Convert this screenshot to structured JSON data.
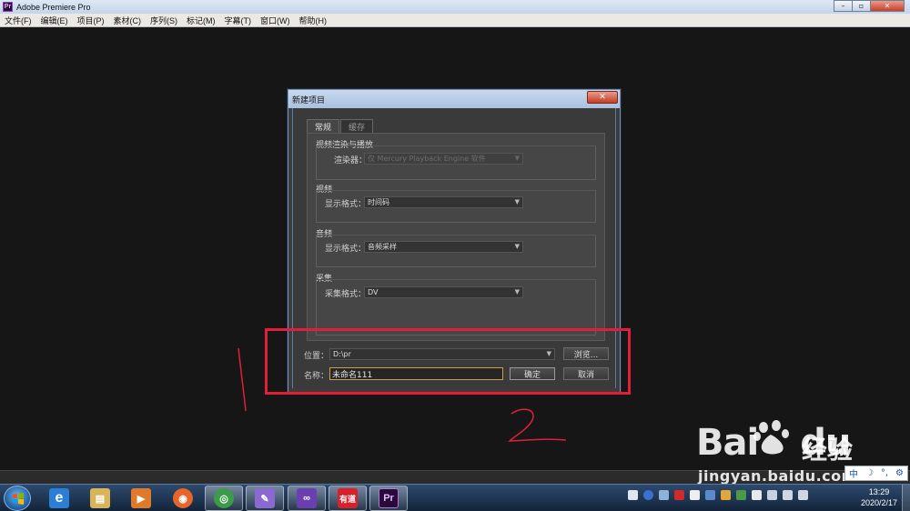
{
  "app": {
    "title": "Adobe Premiere Pro",
    "icon_label": "Pr",
    "controls": {
      "minimize": "–",
      "maximize": "▫",
      "close": "✕"
    }
  },
  "menubar": {
    "items": [
      "文件(F)",
      "编辑(E)",
      "项目(P)",
      "素材(C)",
      "序列(S)",
      "标记(M)",
      "字幕(T)",
      "窗口(W)",
      "帮助(H)"
    ]
  },
  "dialog": {
    "title": "新建项目",
    "close_label": "✕",
    "tabs": [
      {
        "label": "常规",
        "active": true
      },
      {
        "label": "缓存",
        "active": false
      }
    ],
    "groups": {
      "render": {
        "title": "视频渲染与播放",
        "field_label": "渲染器：",
        "value": "仅 Mercury Playback Engine 软件",
        "disabled": true
      },
      "video": {
        "title": "视频",
        "field_label": "显示格式：",
        "value": "时间码"
      },
      "audio": {
        "title": "音频",
        "field_label": "显示格式：",
        "value": "音频采样"
      },
      "capture": {
        "title": "采集",
        "field_label": "采集格式：",
        "value": "DV"
      }
    },
    "location": {
      "label": "位置：",
      "value": "D:\\pr",
      "browse_label": "浏览..."
    },
    "name": {
      "label": "名称：",
      "value": "未命名111"
    },
    "ok_label": "确定",
    "cancel_label": "取消"
  },
  "annotation": {
    "color": "#e0203a"
  },
  "watermark": {
    "brand": "Bai",
    "brand_suffix": "du",
    "cn": "经验",
    "url": "jingyan.baidu.com"
  },
  "ime": {
    "mode": "中",
    "moon": "☽",
    "punct": "°,",
    "settings": "⚙"
  },
  "taskbar": {
    "apps": [
      {
        "name": "internet-explorer",
        "label": "e",
        "color": "#2a7fd4"
      },
      {
        "name": "file-explorer",
        "label": "▤",
        "color": "#d9b45a"
      },
      {
        "name": "media-player",
        "label": "▶",
        "color": "#e07a2a"
      },
      {
        "name": "firefox",
        "label": "◉",
        "color": "#e8652a"
      },
      {
        "name": "chrome",
        "label": "◎",
        "color": "#3a9b48"
      },
      {
        "name": "paint",
        "label": "✎",
        "color": "#8a6ad0"
      },
      {
        "name": "visual-studio",
        "label": "∞",
        "color": "#6a3fb0"
      },
      {
        "name": "youdao",
        "label": "有道",
        "color": "#d8202a"
      },
      {
        "name": "premiere",
        "label": "Pr",
        "color": "#2a0a3a",
        "active": true
      }
    ],
    "clock": {
      "time": "13:29",
      "date": "2020/2/17"
    }
  }
}
